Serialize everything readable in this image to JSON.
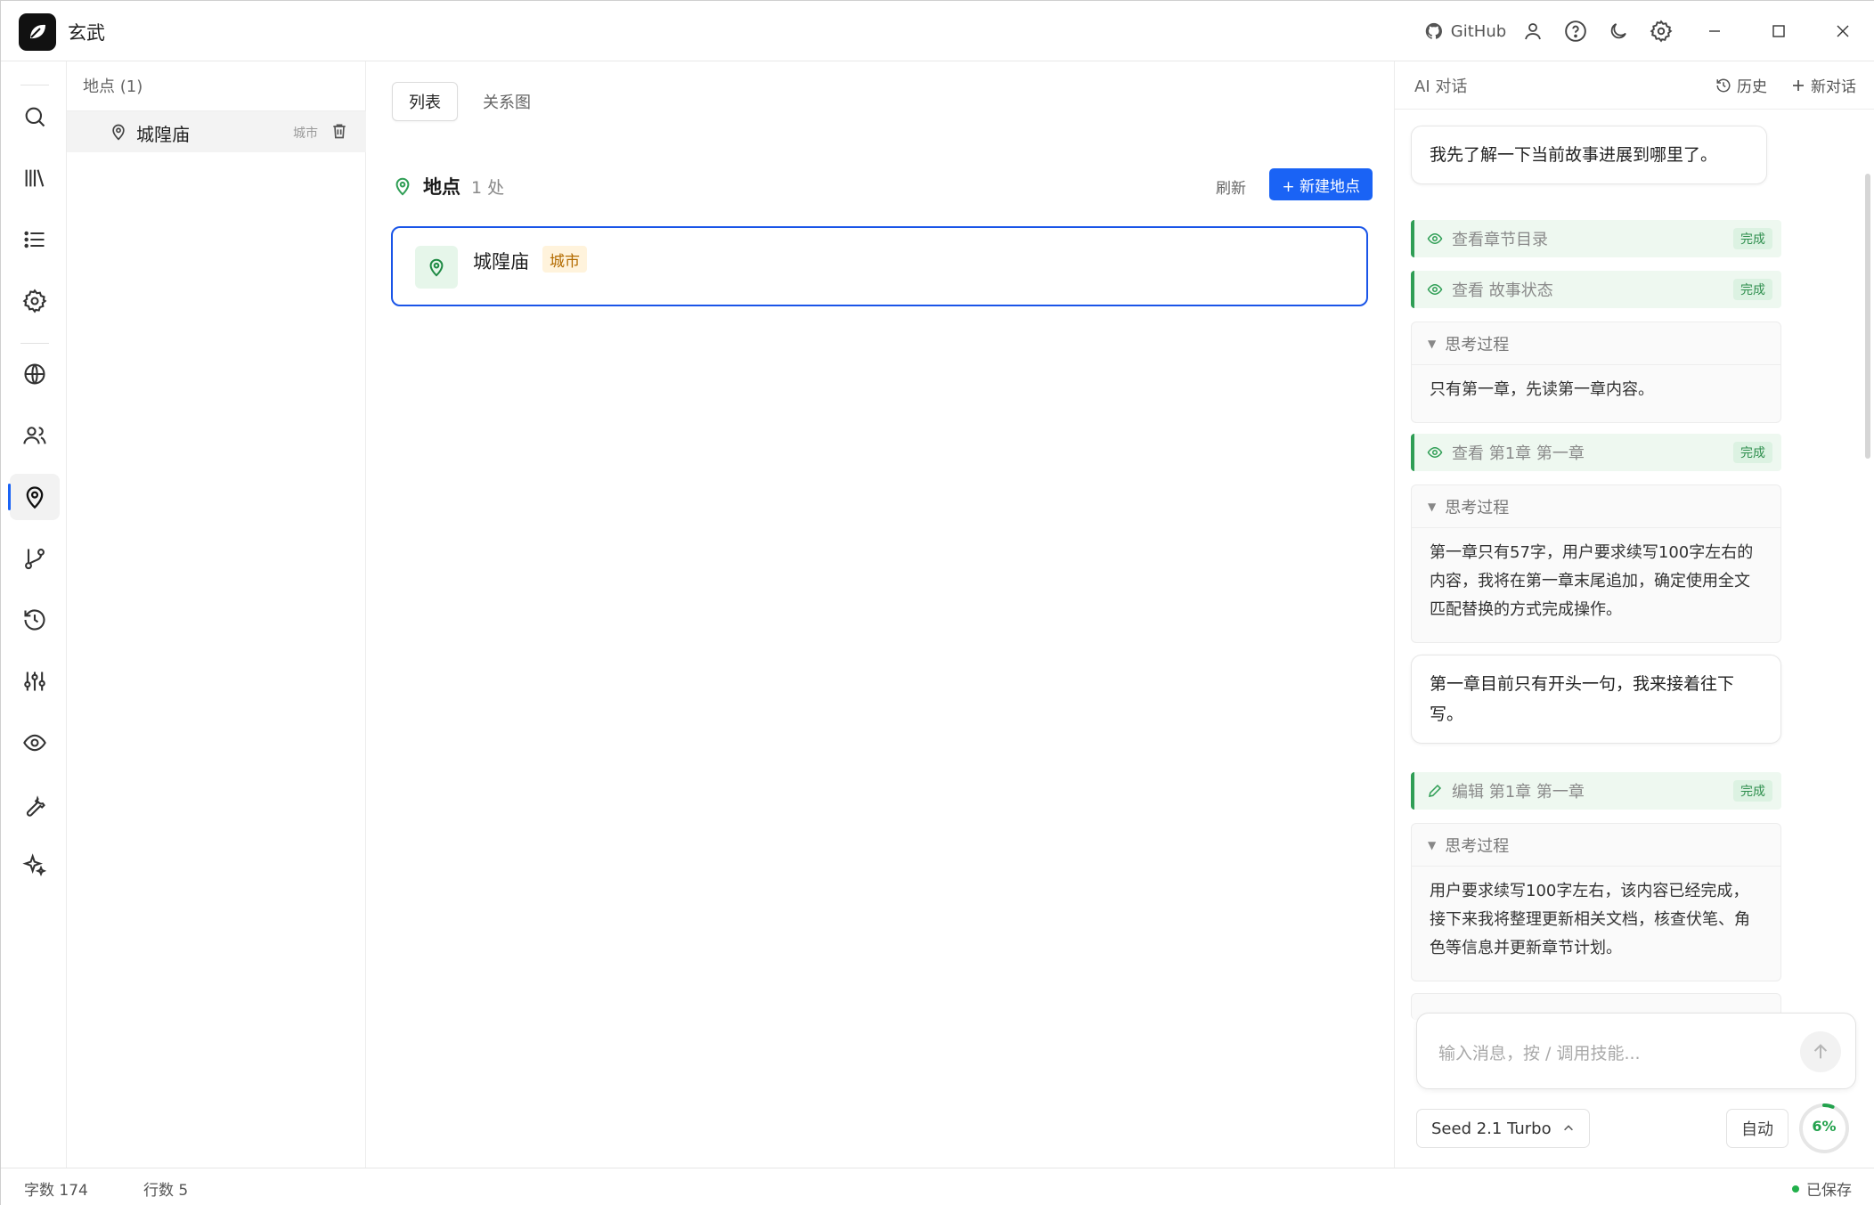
{
  "app": {
    "title": "玄武"
  },
  "titlebar": {
    "github_label": "GitHub"
  },
  "left_panel": {
    "header": "地点 (1)",
    "items": [
      {
        "name": "城隍庙",
        "type": "城市"
      }
    ]
  },
  "main": {
    "tabs": [
      {
        "label": "列表",
        "active": true
      },
      {
        "label": "关系图",
        "active": false
      }
    ],
    "section_title": "地点",
    "section_count": "1 处",
    "refresh_label": "刷新",
    "new_button_label": "+ 新建地点",
    "cards": [
      {
        "name": "城隍庙",
        "tag": "城市"
      }
    ]
  },
  "ai": {
    "title": "AI 对话",
    "history_label": "历史",
    "new_chat_label": "新对话",
    "messages": {
      "m1": "我先了解一下当前故事进展到哪里了。",
      "t1": "查看章节目录",
      "t2": "查看 故事状态",
      "think_label": "思考过程",
      "k1": "只有第一章，先读第一章内容。",
      "t3": "查看 第1章 第一章",
      "k2": "第一章只有57字，用户要求续写100字左右的内容，我将在第一章末尾追加，确定使用全文匹配替换的方式完成操作。",
      "m2": "第一章目前只有开头一句，我来接着往下写。",
      "t4": "编辑 第1章 第一章",
      "k3": "用户要求续写100字左右，该内容已经完成，接下来我将整理更新相关文档，核查伏笔、角色等信息并更新章节计划。",
      "done_label": "完成"
    },
    "input_placeholder": "输入消息，按 / 调用技能...",
    "model": "Seed 2.1 Turbo",
    "auto_label": "自动",
    "context_usage": "6%",
    "context_fraction": 0.06
  },
  "status": {
    "words": "字数 174",
    "lines": "行数 5",
    "saved": "已保存"
  },
  "colors": {
    "accent": "#1a63f5",
    "success": "#2f9e55",
    "tag_bg": "#fff3dc",
    "tag_fg": "#b36b00"
  }
}
